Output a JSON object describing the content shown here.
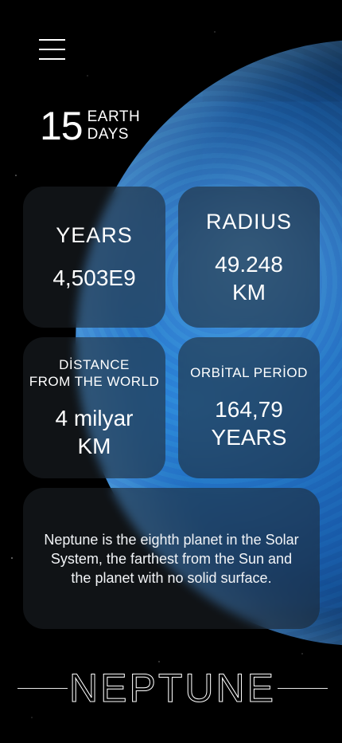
{
  "header": {
    "menu_icon": "hamburger-icon"
  },
  "days": {
    "number": "15",
    "unit_line1": "EARTH",
    "unit_line2": "DAYS"
  },
  "stats": [
    {
      "title": "YEARS",
      "value": "4,503E9"
    },
    {
      "title": "RADIUS",
      "value": "49.248\nKM"
    },
    {
      "title": "DİSTANCE\nFROM THE WORLD",
      "value": "4 milyar\nKM"
    },
    {
      "title": "ORBİTAL PERİOD",
      "value": "164,79\nYEARS"
    }
  ],
  "description": "Neptune is the eighth planet in the Solar System, the farthest from the Sun and the planet with no solid surface.",
  "planet_name": "NEPTUNE",
  "colors": {
    "background": "#000000",
    "planet": "#2a86d8",
    "card": "#1e2228"
  }
}
